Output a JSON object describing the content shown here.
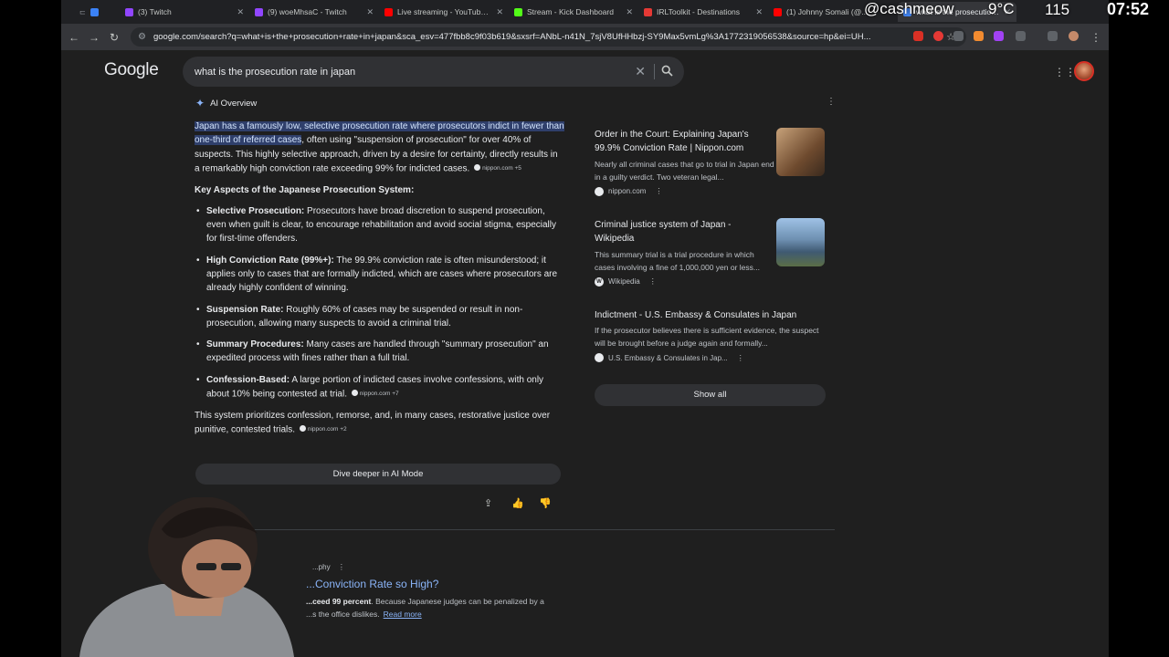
{
  "tabs": [
    {
      "title": "",
      "color": "#3b82f6"
    },
    {
      "title": "(3) Twitch",
      "color": "#9146ff"
    },
    {
      "title": "(9) woeMhsaC - Twitch",
      "color": "#9146ff"
    },
    {
      "title": "Live streaming - YouTube Studio",
      "color": "#ff0000"
    },
    {
      "title": "Stream - Kick Dashboard",
      "color": "#53fc18"
    },
    {
      "title": "IRLToolkit - Destinations",
      "color": "#e53935"
    },
    {
      "title": "(1) Johnny Somali (@...",
      "color": "#ff0000"
    },
    {
      "title": "what is the prosecution rate in japan",
      "color": "#4285f4"
    }
  ],
  "toolbar": {
    "url": "google.com/search?q=what+is+the+prosecution+rate+in+japan&sca_esv=477fbb8c9f03b619&sxsrf=ANbL-n41N_7sjV8UfHHbzj-SY9Max5vmLg%3A1772319056538&source=hp&ei=UH..."
  },
  "overlay": {
    "username": "@cashmeow",
    "temperature": "9°C",
    "count": "115",
    "time": "07:52"
  },
  "google": {
    "logo": "Google",
    "query": "what is the prosecution rate in japan"
  },
  "ai_overview": {
    "heading": "AI Overview",
    "intro_highlight": "Japan has a famously low, selective prosecution rate where prosecutors indict in fewer than one-third of referred cases",
    "intro_rest": ", often using \"suspension of prosecution\" for over 40% of suspects. This highly selective approach, driven by a desire for certainty, directly results in a remarkably high conviction rate exceeding 99% for indicted cases.",
    "intro_chip": "nippon.com +5",
    "key_heading": "Key Aspects of the Japanese Prosecution System:",
    "aspects": [
      {
        "term": "Selective Prosecution:",
        "text": " Prosecutors have broad discretion to suspend prosecution, even when guilt is clear, to encourage rehabilitation and avoid social stigma, especially for first-time offenders.",
        "chip": ""
      },
      {
        "term": "High Conviction Rate (99%+):",
        "text": " The 99.9% conviction rate is often misunderstood; it applies only to cases that are formally indicted, which are cases where prosecutors are already highly confident of winning.",
        "chip": ""
      },
      {
        "term": "Suspension Rate:",
        "text": " Roughly 60% of cases may be suspended or result in non-prosecution, allowing many suspects to avoid a criminal trial.",
        "chip": ""
      },
      {
        "term": "Summary Procedures:",
        "text": " Many cases are handled through \"summary prosecution\" an expedited process with fines rather than a full trial.",
        "chip": ""
      },
      {
        "term": "Confession-Based:",
        "text": " A large portion of indicted cases involve confessions, with only about 10% being contested at trial.",
        "chip": "nippon.com +7"
      }
    ],
    "closing": "This system prioritizes confession, remorse, and, in many cases, restorative justice over punitive, contested trials.",
    "closing_chip": "nippon.com +2",
    "dive_deeper": "Dive deeper in AI Mode"
  },
  "sources": [
    {
      "title": "Order in the Court: Explaining Japan's 99.9% Conviction Rate | Nippon.com",
      "snippet": "Nearly all criminal cases that go to trial in Japan end in a guilty verdict. Two veteran legal...",
      "site": "nippon.com",
      "thumb": "#8a6a4a"
    },
    {
      "title": "Criminal justice system of Japan - Wikipedia",
      "snippet": "This summary trial is a trial procedure in which cases involving a fine of 1,000,000 yen or less...",
      "site": "Wikipedia",
      "thumb": "#6f8aa8"
    },
    {
      "title": "Indictment - U.S. Embassy & Consulates in Japan",
      "snippet": "If the prosecutor believes there is sufficient evidence, the suspect will be brought before a judge again and formally...",
      "site": "U.S. Embassy & Consulates in Jap..."
    }
  ],
  "show_all": "Show all",
  "result": {
    "source_tail": "...phy",
    "title": "...Conviction Rate so High?",
    "snippet_bold": "...ceed 99 percent",
    "snippet_rest": ". Because Japanese judges can be penalized by a",
    "snippet2": "...s the office dislikes.",
    "read_more": "Read more"
  }
}
